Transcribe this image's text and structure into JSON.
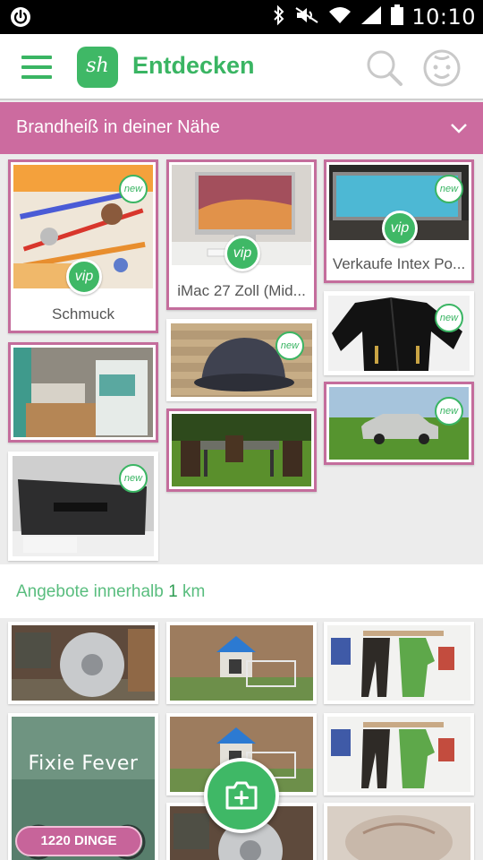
{
  "status_bar": {
    "time": "10:10"
  },
  "app_bar": {
    "logo_text": "sh",
    "title": "Entdecken"
  },
  "hot_section": {
    "title": "Brandheiß in deiner Nähe"
  },
  "hot_items": [
    {
      "caption": "Schmuck",
      "badge_vip": "vip",
      "badge_new": "new"
    },
    {
      "caption": "iMac 27 Zoll (Mid...",
      "badge_vip": "vip"
    },
    {
      "caption": "Verkaufe Intex Po...",
      "badge_vip": "vip",
      "badge_new": "new"
    },
    {
      "badge_new": "new"
    },
    {
      "badge_new": "new"
    },
    {
      "badge_new": "new"
    },
    {
      "badge_new": "new"
    }
  ],
  "near_section": {
    "prefix": "Angebote innerhalb ",
    "distance": "1",
    "unit": " km"
  },
  "promo": {
    "title": "Fixie Fever",
    "pill": "1220 DINGE"
  },
  "colors": {
    "accent_green": "#3ab563",
    "pink": "#cc6b9f"
  }
}
